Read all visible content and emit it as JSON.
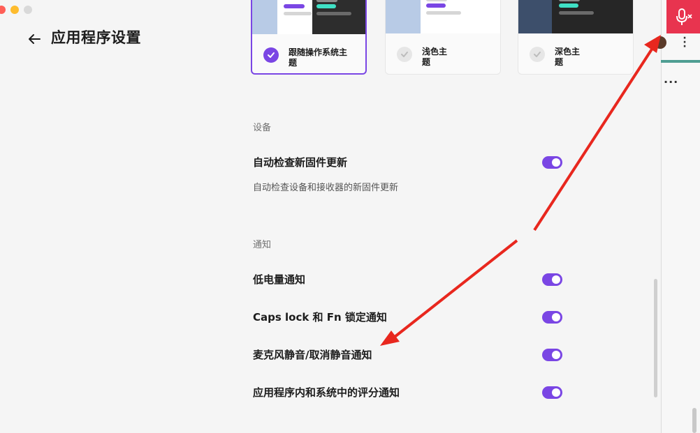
{
  "page": {
    "title": "应用程序设置"
  },
  "themes": [
    {
      "label": "跟随操作系统主题",
      "selected": true
    },
    {
      "label": "浅色主题",
      "selected": false
    },
    {
      "label": "深色主题",
      "selected": false
    }
  ],
  "sections": {
    "device": {
      "title": "设备",
      "settings": [
        {
          "label": "自动检查新固件更新",
          "description": "自动检查设备和接收器的新固件更新",
          "enabled": true
        }
      ]
    },
    "notifications": {
      "title": "通知",
      "settings": [
        {
          "label": "低电量通知",
          "enabled": true
        },
        {
          "label": "Caps lock 和 Fn 锁定通知",
          "enabled": true
        },
        {
          "label": "麦克风静音/取消静音通知",
          "enabled": true
        },
        {
          "label": "应用程序内和系统中的评分通知",
          "enabled": true
        }
      ]
    }
  },
  "colors": {
    "accent": "#7a46e4",
    "mic": "#e8344f",
    "arrow": "#e8271e"
  },
  "icons": {
    "back": "arrow-left-icon",
    "mic": "microphone-mute-icon"
  }
}
